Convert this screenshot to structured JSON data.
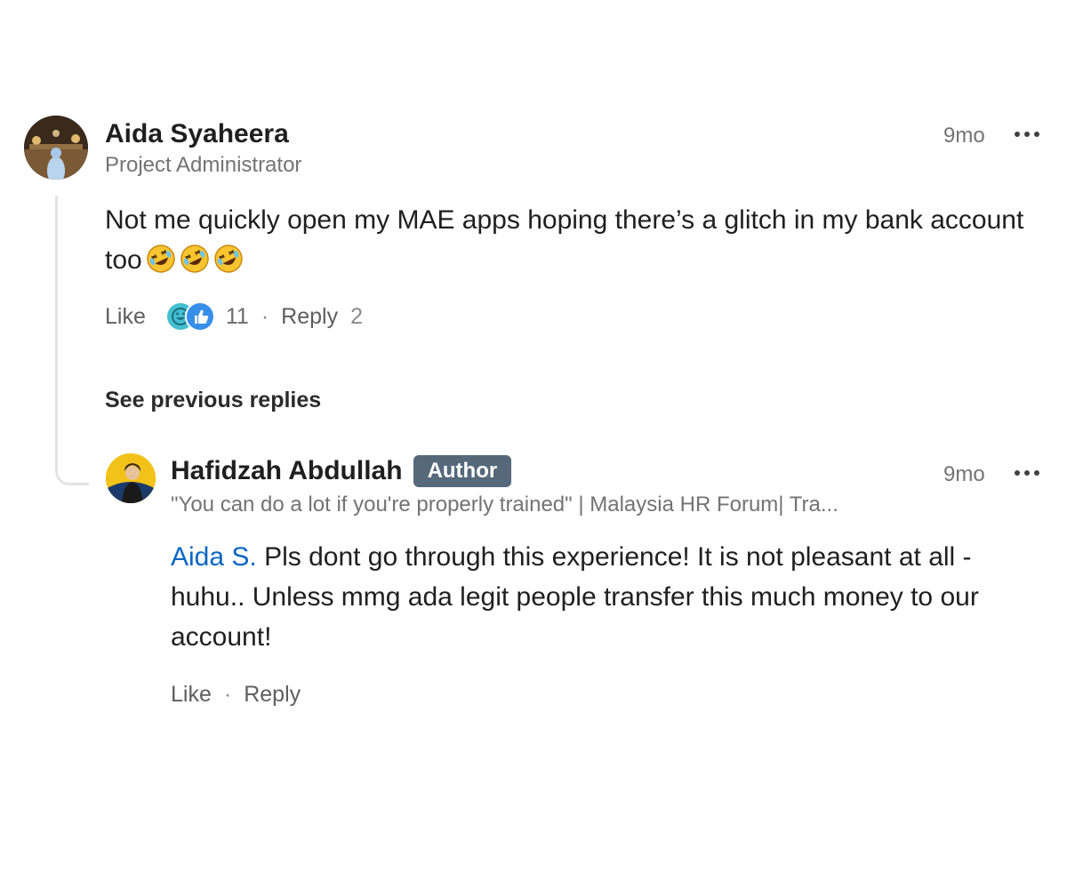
{
  "parent_comment": {
    "author": "Aida Syaheera",
    "headline": "Project Administrator",
    "time": "9mo",
    "text": "Not me quickly open my MAE apps hoping there’s a glitch in my bank account too",
    "emoji_icons": [
      "rolling-on-floor-laughing",
      "rolling-on-floor-laughing",
      "rolling-on-floor-laughing"
    ],
    "actions": {
      "like_label": "Like",
      "reaction_icons": [
        "funny",
        "like"
      ],
      "reaction_count": "11",
      "separator": "·",
      "reply_label": "Reply",
      "reply_count": "2"
    }
  },
  "see_previous_label": "See previous replies",
  "reply_comment": {
    "author": "Hafidzah Abdullah",
    "badge": "Author",
    "headline": "\"You can do a lot if you're properly trained\" | Malaysia HR Forum| Tra...",
    "time": "9mo",
    "mention": "Aida S.",
    "text": " Pls dont go through this experience! It is not pleasant at all - huhu.. Unless mmg ada legit people transfer this much money to our account!",
    "actions": {
      "like_label": "Like",
      "separator": "·",
      "reply_label": "Reply"
    }
  },
  "colors": {
    "mention": "#0a66c2",
    "badge_bg": "#56687a",
    "muted_text": "#737373",
    "thread_line": "#e3e3e3"
  }
}
